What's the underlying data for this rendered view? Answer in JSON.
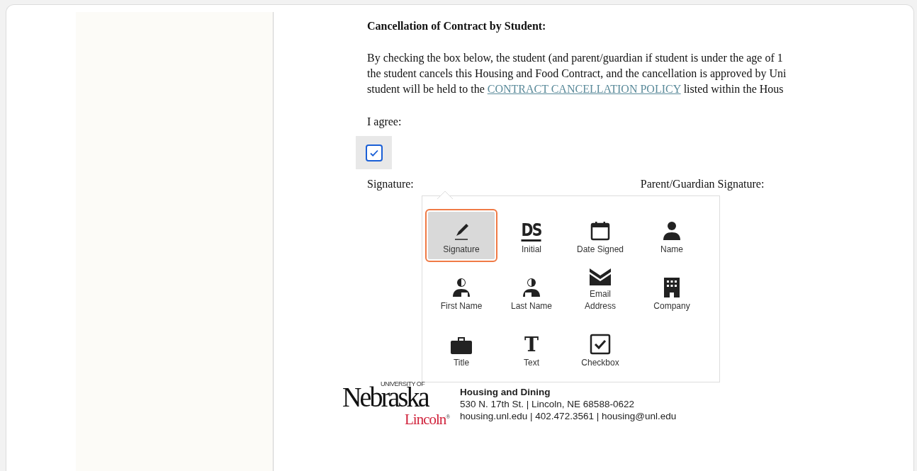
{
  "document": {
    "heading": "Cancellation of Contract by Student:",
    "paragraph": [
      {
        "text": "By checking the box below, the student (and parent/guardian if student is under the age of 1"
      },
      {
        "text": "the student cancels this Housing and Food Contract, and the cancellation is approved by Uni"
      },
      {
        "text": "student will be held to the ",
        "link": "CONTRACT CANCELLATION POLICY",
        "after": " listed within the Hous"
      }
    ],
    "agree_label": "I agree:",
    "agree_checked": true,
    "signature_label": "Signature:",
    "parent_signature_label": "Parent/Guardian Signature:"
  },
  "field_menu": {
    "items": [
      {
        "kind": "signature",
        "label": "Signature",
        "selected": true
      },
      {
        "kind": "initial",
        "glyph": "DS",
        "label": "Initial",
        "selected": false
      },
      {
        "kind": "date",
        "label": "Date Signed",
        "selected": false
      },
      {
        "kind": "name",
        "label": "Name",
        "selected": false
      },
      {
        "kind": "first-name",
        "label": "First Name",
        "selected": false
      },
      {
        "kind": "last-name",
        "label": "Last Name",
        "selected": false
      },
      {
        "kind": "email",
        "label": "Email Address",
        "selected": false
      },
      {
        "kind": "company",
        "label": "Company",
        "selected": false
      },
      {
        "kind": "title",
        "label": "Title",
        "selected": false
      },
      {
        "kind": "text",
        "glyph": "T",
        "label": "Text",
        "selected": false
      },
      {
        "kind": "checkbox",
        "label": "Checkbox",
        "selected": false
      }
    ]
  },
  "footer": {
    "logo": {
      "top": "UNIVERSITY OF",
      "main": "Nebraska",
      "sub": "Lincoln",
      "mark": "®"
    },
    "lines": [
      "Housing and Dining",
      "530 N. 17th St. | Lincoln, NE 68588-0622",
      "housing.unl.edu | 402.472.3561 | housing@unl.edu"
    ]
  }
}
